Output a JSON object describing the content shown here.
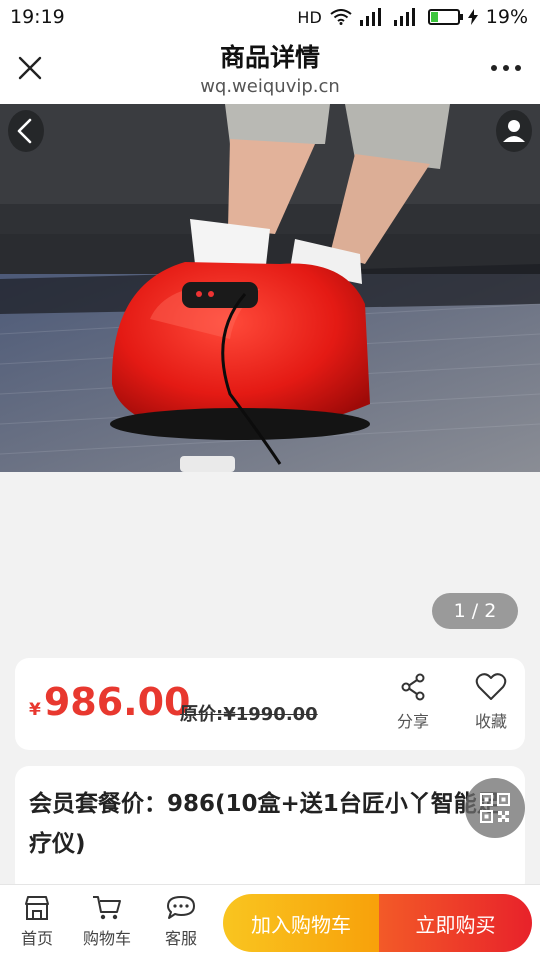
{
  "status_bar": {
    "time": "19:19",
    "network": "HD",
    "battery_percent": "19%",
    "battery_level": 0.19
  },
  "nav": {
    "title": "商品详情",
    "subtitle": "wq.weiquvip.cn"
  },
  "gallery": {
    "pager": "1 / 2",
    "image_icon": "foot-massager-photo"
  },
  "price": {
    "symbol": "¥",
    "current": "986.00",
    "original": "原价:¥1990.00"
  },
  "actions": {
    "share_label": "分享",
    "favorite_label": "收藏"
  },
  "product": {
    "title": "会员套餐价：986(10盒+送1台匠小丫智能足疗仪)"
  },
  "bottom_nav": {
    "home_label": "首页",
    "cart_label": "购物车",
    "service_label": "客服"
  },
  "buttons": {
    "add_to_cart": "加入购物车",
    "buy_now": "立即购买"
  },
  "colors": {
    "price": "#e8382f",
    "cart_button": "#f9b81a",
    "buy_button": "#ea2e2a"
  }
}
